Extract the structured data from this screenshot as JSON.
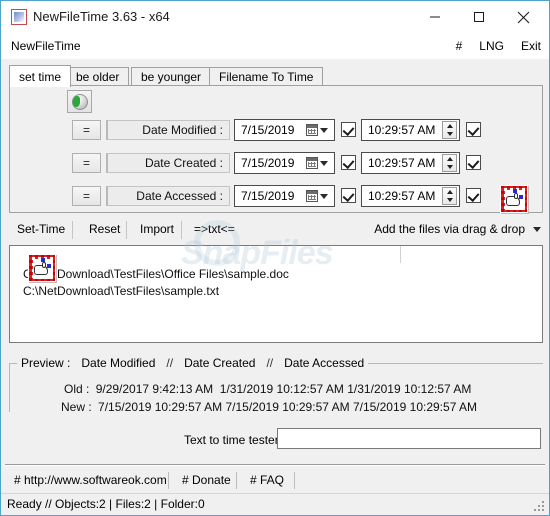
{
  "window": {
    "title": "NewFileTime 3.63 - x64",
    "icon": "app-calendar-icon",
    "minimize": "minimize-icon",
    "maximize": "maximize-icon",
    "close": "close-icon",
    "border_color": "#4ea3c8"
  },
  "menubar": {
    "app_name": "NewFileTime",
    "hash": "#",
    "lng": "LNG",
    "exit": "Exit"
  },
  "tabs": [
    {
      "label": "set time",
      "active": true
    },
    {
      "label": "be older",
      "active": false
    },
    {
      "label": "be younger",
      "active": false
    },
    {
      "label": "Filename To Time",
      "active": false
    }
  ],
  "settime": {
    "globe_button": "globe-icon",
    "icon_right": "set-time-calendar-icon",
    "icon_left": "set-time-calendar-icon",
    "rows": [
      {
        "equals_label": "=",
        "label": "Date Modified :",
        "date_value": "7/15/2019",
        "date_checkbox_checked": true,
        "time_value": "10:29:57 AM",
        "time_checkbox_checked": true
      },
      {
        "equals_label": "=",
        "label": "Date Created :",
        "date_value": "7/15/2019",
        "date_checkbox_checked": true,
        "time_value": "10:29:57 AM",
        "time_checkbox_checked": true
      },
      {
        "equals_label": "=",
        "label": "Date Accessed :",
        "date_value": "7/15/2019",
        "date_checkbox_checked": true,
        "time_value": "10:29:57 AM",
        "time_checkbox_checked": true
      }
    ]
  },
  "toolbar": {
    "set_time": "Set-Time",
    "reset": "Reset",
    "import": "Import",
    "to_txt": "=>txt<=",
    "drag_drop": "Add the files via drag & drop"
  },
  "filelist": {
    "watermark": "SnapFiles",
    "files": [
      "C:\\NetDownload\\TestFiles\\Office Files\\sample.doc",
      "C:\\NetDownload\\TestFiles\\sample.txt"
    ]
  },
  "preview": {
    "title_prefix": "Preview :",
    "col_modified": "Date Modified",
    "col_created": "Date Created",
    "col_accessed": "Date Accessed",
    "separator": "//",
    "old_label": "Old :",
    "old_modified": "9/29/2017 9:42:13 AM",
    "old_created": "1/31/2019 10:12:57 AM",
    "old_accessed": "1/31/2019 10:12:57 AM",
    "new_label": "New :",
    "new_modified": "7/15/2019 10:29:57 AM",
    "new_created": "7/15/2019 10:29:57 AM",
    "new_accessed": "7/15/2019 10:29:57 AM"
  },
  "tester": {
    "label": "Text to time tester",
    "value": "",
    "placeholder": ""
  },
  "links": {
    "website": "# http://www.softwareok.com",
    "donate": "# Donate",
    "faq": "# FAQ"
  },
  "status": {
    "text": "Ready // Objects:2 | Files:2  | Folder:0"
  }
}
